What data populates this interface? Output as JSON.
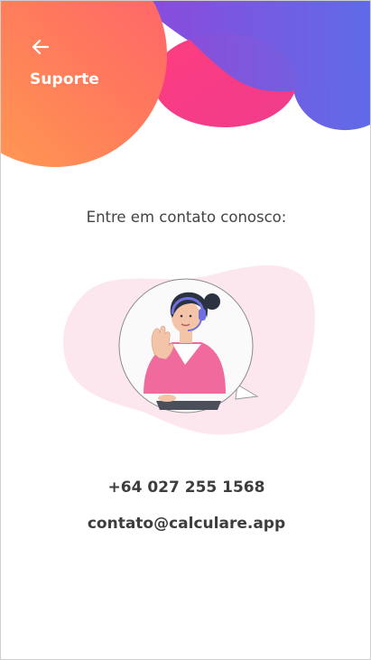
{
  "header": {
    "title": "Suporte",
    "back_icon": "arrow-left-icon"
  },
  "content": {
    "intro": "Entre em contato conosco:",
    "illustration": "support-agent-headset-illustration",
    "phone": "+64 027 255 1568",
    "email": "contato@calculare.app"
  },
  "colors": {
    "purple": "#6a63e6",
    "pink": "#f43f8a",
    "orange_start": "#ff9c50",
    "orange_end": "#ff5f6d",
    "text": "#3d3d3d",
    "blob_pink": "#fde7ef"
  }
}
